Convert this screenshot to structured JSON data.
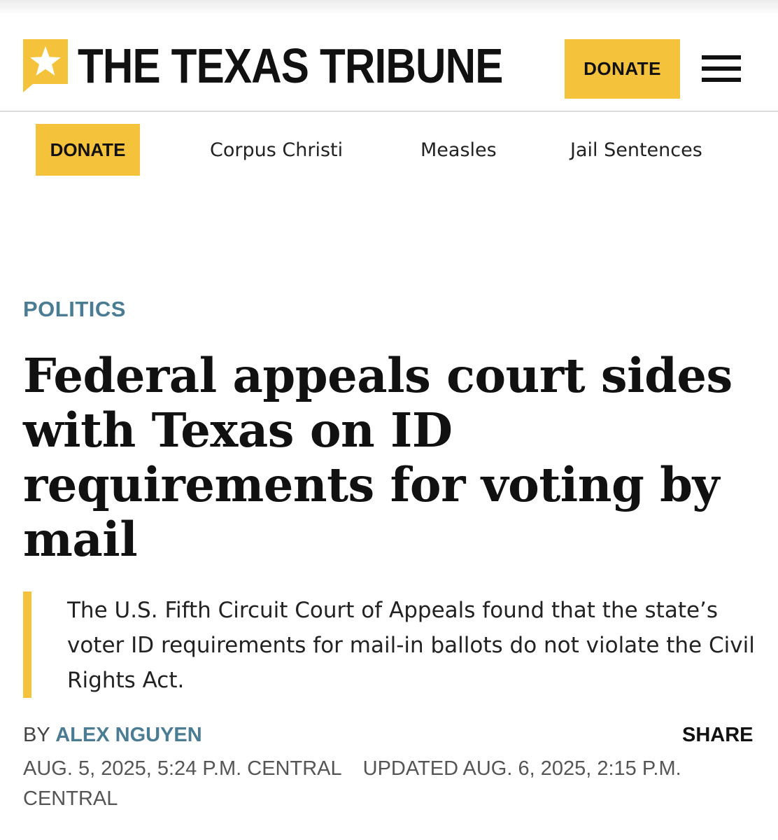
{
  "header": {
    "logo_text": "THE TEXAS TRIBUNE",
    "logo_icon": "star-speech-bubble-icon",
    "donate_label": "DONATE",
    "menu_icon": "hamburger-menu-icon"
  },
  "nav": {
    "donate_label": "DONATE",
    "links": [
      {
        "label": "Corpus Christi"
      },
      {
        "label": "Measles"
      },
      {
        "label": "Jail Sentences"
      }
    ]
  },
  "article": {
    "category": "POLITICS",
    "headline": "Federal appeals court sides with Texas on ID requirements for voting by mail",
    "dek": "The U.S. Fifth Circuit Court of Appeals found that the state’s voter ID requirements for mail-in ballots do not violate the Civil Rights Act.",
    "byline_prefix": "BY",
    "author": "ALEX NGUYEN",
    "share_label": "SHARE",
    "published": "AUG. 5, 2025, 5:24 P.M. CENTRAL",
    "updated": "UPDATED AUG. 6, 2025, 2:15 P.M. CENTRAL"
  },
  "colors": {
    "accent_yellow": "#f5c33b",
    "category_blue": "#4a7c93",
    "text_dark": "#111111"
  }
}
